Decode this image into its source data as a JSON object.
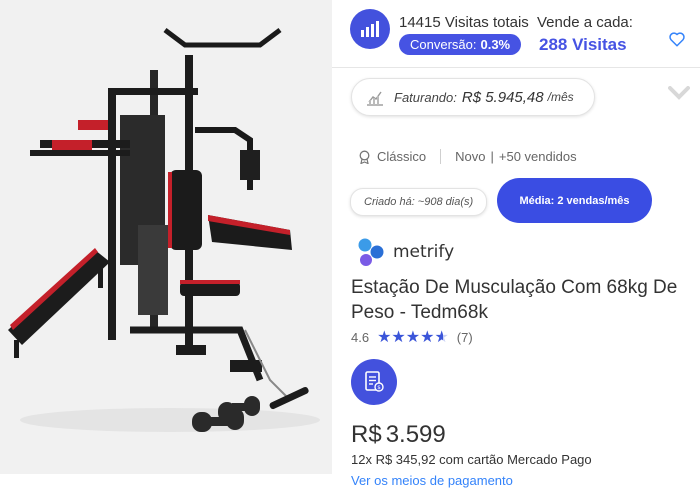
{
  "stats": {
    "visits_total": "14415 Visitas totais",
    "conversion_label": "Conversão:",
    "conversion_value": "0.3%",
    "sells_every_label": "Vende a cada:",
    "visits_count": "288 Visitas"
  },
  "revenue": {
    "label": "Faturando:",
    "value": "R$ 5.945,48",
    "unit": "/mês"
  },
  "meta": {
    "listing_type": "Clássico",
    "condition": "Novo",
    "sold": "+50 vendidos"
  },
  "created": "Criado há: ~908 dia(s)",
  "average": "Média: 2 vendas/mês",
  "brand": {
    "name": "metrify"
  },
  "product": {
    "title": "Estação De Musculação Com 68kg De Peso - Tedm68k",
    "rating_value": "4.6",
    "rating_count": "(7)",
    "rating": 4.6,
    "price_currency": "R$",
    "price_value": "3.599",
    "installments": "12x R$ 345,92 com cartão Mercado Pago",
    "payment_link": "Ver os meios de pagamento"
  },
  "colors": {
    "accent": "#4653e3",
    "link": "#3483fa",
    "star": "#3b55d9"
  },
  "icons": [
    "bar-chart-icon",
    "heart-icon",
    "revenue-chart-icon",
    "chevron-down-icon",
    "medal-icon",
    "metrify-logo-icon",
    "invoice-icon"
  ]
}
